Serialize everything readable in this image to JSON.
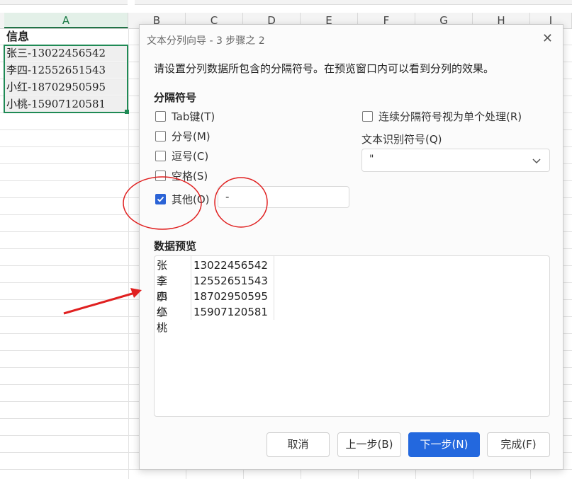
{
  "sheet": {
    "columns": [
      "A",
      "B",
      "C",
      "D",
      "E",
      "F",
      "G",
      "H",
      "I"
    ],
    "header_cell": "信息",
    "rows": [
      "张三-13022456542",
      "李四-12552651543",
      "小红-18702950595",
      "小桃-15907120581"
    ]
  },
  "dialog": {
    "title": "文本分列向导 - 3 步骤之 2",
    "description": "请设置分列数据所包含的分隔符号。在预览窗口内可以看到分列的效果。",
    "delimiters_label": "分隔符号",
    "options": {
      "tab": "Tab键(T)",
      "semicolon": "分号(M)",
      "comma": "逗号(C)",
      "space": "空格(S)",
      "other": "其他(O)"
    },
    "other_value": "-",
    "consecutive": "连续分隔符号视为单个处理(R)",
    "qualifier_label": "文本识别符号(Q)",
    "qualifier_value": "\"",
    "preview_label": "数据预览",
    "preview_rows": [
      {
        "name": "张三",
        "number": "13022456542"
      },
      {
        "name": "李四",
        "number": "12552651543"
      },
      {
        "name": "小红",
        "number": "18702950595"
      },
      {
        "name": "小桃",
        "number": "15907120581"
      }
    ],
    "buttons": {
      "cancel": "取消",
      "back": "上一步(B)",
      "next": "下一步(N)",
      "finish": "完成(F)"
    },
    "states": {
      "tab": false,
      "semicolon": false,
      "comma": false,
      "space": false,
      "other": true,
      "consecutive": false
    }
  },
  "colors": {
    "accent": "#2368de",
    "selection": "#1f8a55",
    "annotation": "#e02020"
  }
}
